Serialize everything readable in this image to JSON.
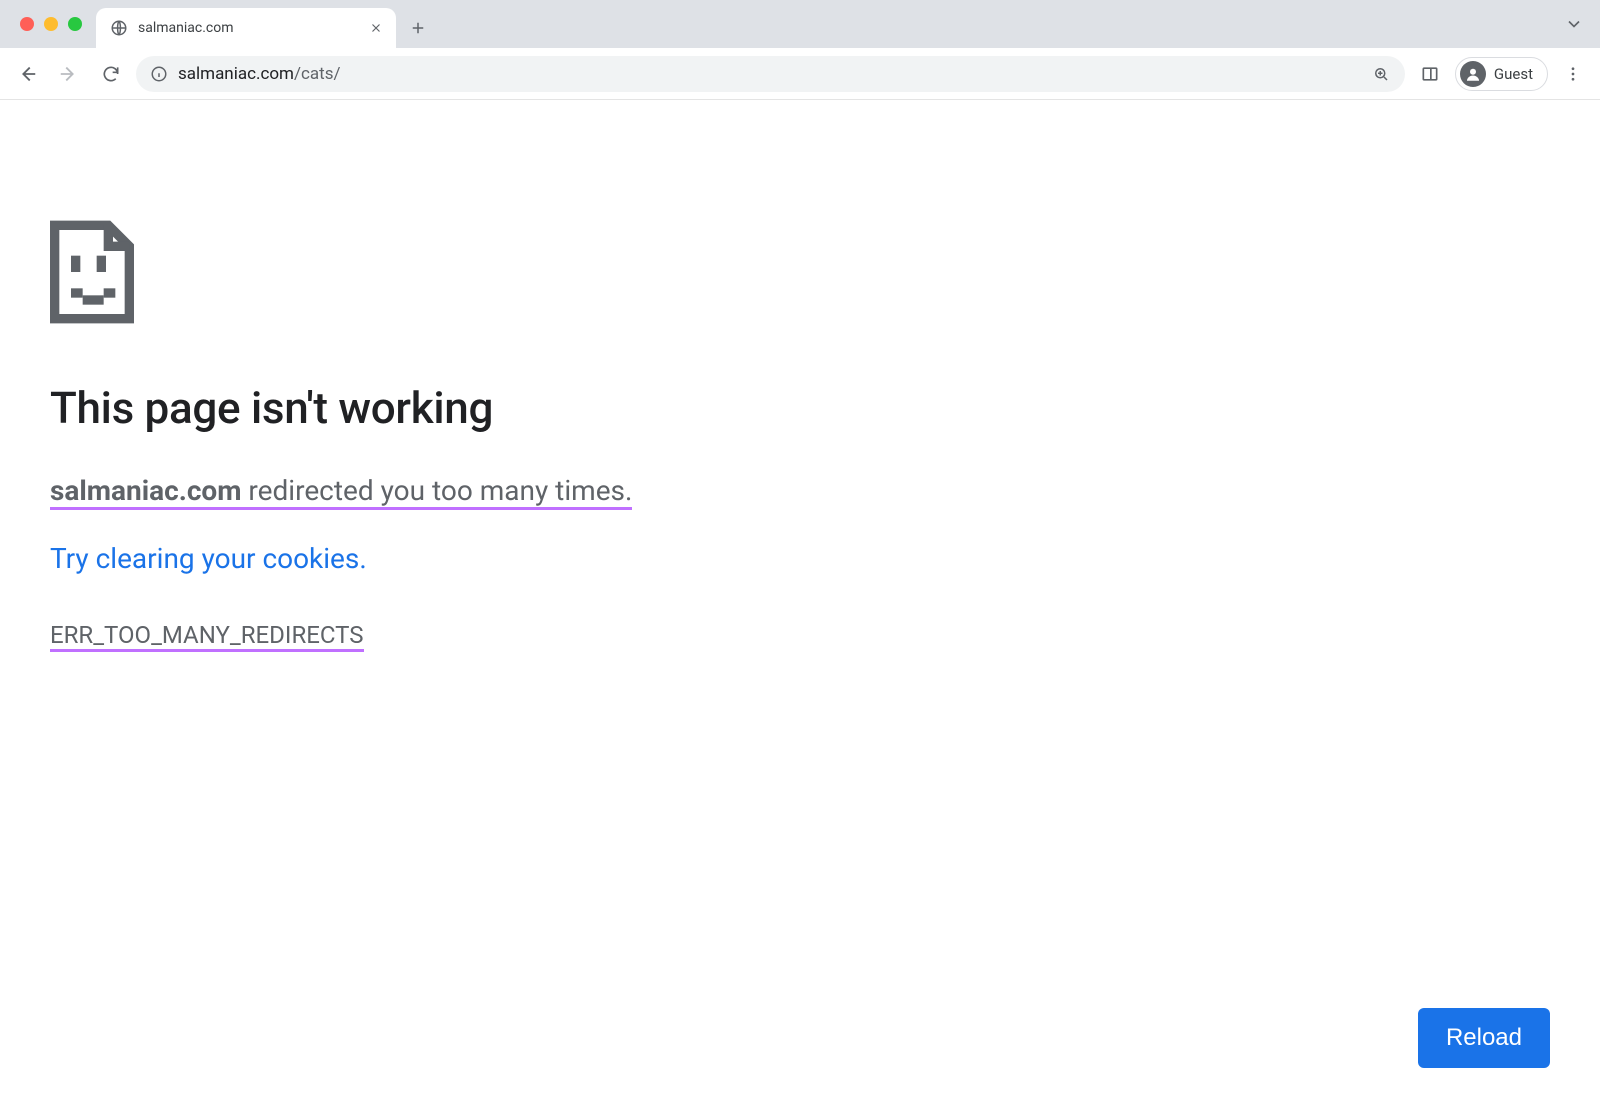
{
  "tab": {
    "title": "salmaniac.com"
  },
  "toolbar": {
    "url_host": "salmaniac.com",
    "url_path": "/cats/",
    "profile_label": "Guest"
  },
  "error": {
    "headline": "This page isn't working",
    "host": "salmaniac.com",
    "redirect_msg": " redirected you too many times. ",
    "suggestion_link": "Try clearing your cookies",
    "suggestion_period": ".",
    "error_code": "ERR_TOO_MANY_REDIRECTS",
    "reload_label": "Reload"
  },
  "colors": {
    "accent": "#1a73e8",
    "highlight": "#c070ff"
  }
}
